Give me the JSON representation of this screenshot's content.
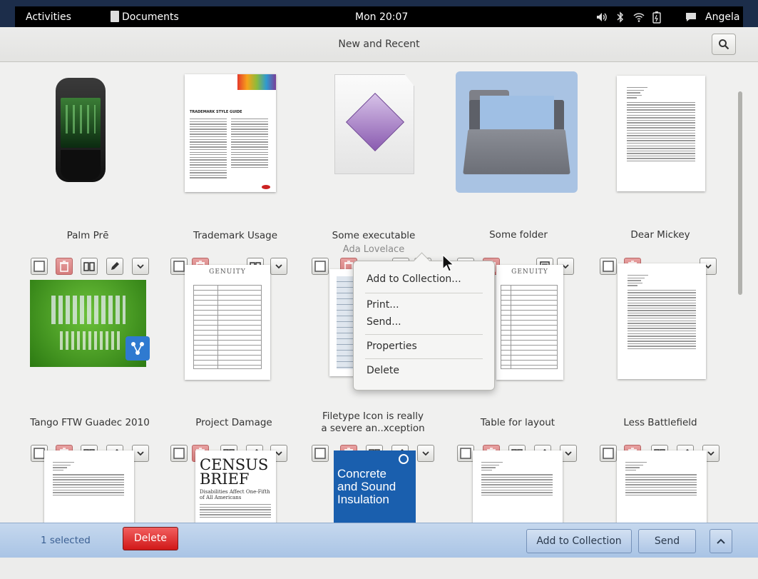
{
  "top_bar": {
    "activities": "Activities",
    "app_name": "Documents",
    "clock": "Mon 20:07",
    "user": "Angela"
  },
  "header": {
    "title": "New and Recent"
  },
  "items": [
    {
      "title": "Palm Prē"
    },
    {
      "title": "Trademark Usage",
      "thumb_title": "TRADEMARK STYLE GUIDE"
    },
    {
      "title": "Some executable",
      "author": "Ada Lovelace"
    },
    {
      "title": "Some folder"
    },
    {
      "title": "Dear Mickey"
    },
    {
      "title": "Tango FTW Guadec 2010"
    },
    {
      "title": "Project Damage",
      "thumb_header": "GENUITY"
    },
    {
      "title_line1": "Filetype Icon is really",
      "title_line2": "a severe an..xception"
    },
    {
      "title": "Table for layout",
      "thumb_header": "GENUITY"
    },
    {
      "title": "Less Battlefield"
    }
  ],
  "row3": {
    "census_title_1": "CENSUS",
    "census_title_2": "BRIEF",
    "census_subtitle": "Disabilities Affect One-Fifth of All Americans",
    "concrete_line1": "Concrete",
    "concrete_line2": "and Sound",
    "concrete_line3": "Insulation"
  },
  "context_menu": {
    "add_to_collection": "Add to Collection...",
    "print": "Print...",
    "send": "Send...",
    "properties": "Properties",
    "delete": "Delete"
  },
  "action_bar": {
    "selected_count": "1 selected",
    "delete": "Delete",
    "add_to_collection": "Add to Collection",
    "send": "Send"
  },
  "colors": {
    "top_bar": "#000000",
    "selection_bar": "#aec6e6",
    "delete_button": "#d01818",
    "folder_selected_bg": "#a9c3e3"
  }
}
